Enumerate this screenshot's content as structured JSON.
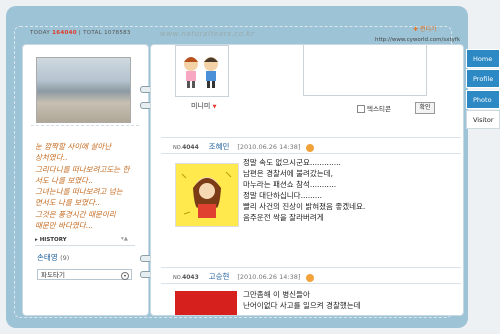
{
  "counters": {
    "today_label": "TODAY",
    "today_value": "164040",
    "total_label": "TOTAL",
    "total_value": "1078583"
  },
  "site_name": "www.naturaltears.co.kr",
  "edit_link": "✚ 편디기",
  "url": "http://www.cyworld.com/sxtyfk",
  "tabs": [
    "Home",
    "Profile",
    "Photo",
    "Visitor"
  ],
  "diary": [
    "눈 깜짝할 사이에 살아난",
    "상처였다..",
    "그리다니를 떠나보려고도는 한",
    "서도 나를 보였다..",
    "그녀는나를 떠나보려고 넘는",
    "면서도 나를 보였다..",
    "그것은 풍경시간 때문이리",
    "때문만 바다였다..."
  ],
  "history": {
    "label": "HISTORY",
    "control": "▾▲",
    "name": "손태영",
    "count": "(9)",
    "select": "파도타기"
  },
  "minihome": {
    "minimi_label": "미니미",
    "checkbox_label": "텍스티콘",
    "confirm_btn": "확인"
  },
  "posts": [
    {
      "no": "4044",
      "author": "조혜민",
      "date": "[2010.06.26 14:38]",
      "lines": [
        "정말 속도 없으시군요.............",
        "남편은 경찰서에 불려갔는데,",
        "마누라는 패션쇼 참석...........",
        "정말 대단하십니다.........",
        "빨리 사건의 진상이 밝혀졌음 좋겠네요.",
        "음주운전 싹을 잘라버려게"
      ]
    },
    {
      "no": "4043",
      "author": "고승현",
      "date": "[2010.06.26 14:38]",
      "lines": [
        "그만좀해 이 병신들아",
        "난어이없다 사고를 일으켜 경찰했는데"
      ]
    }
  ]
}
